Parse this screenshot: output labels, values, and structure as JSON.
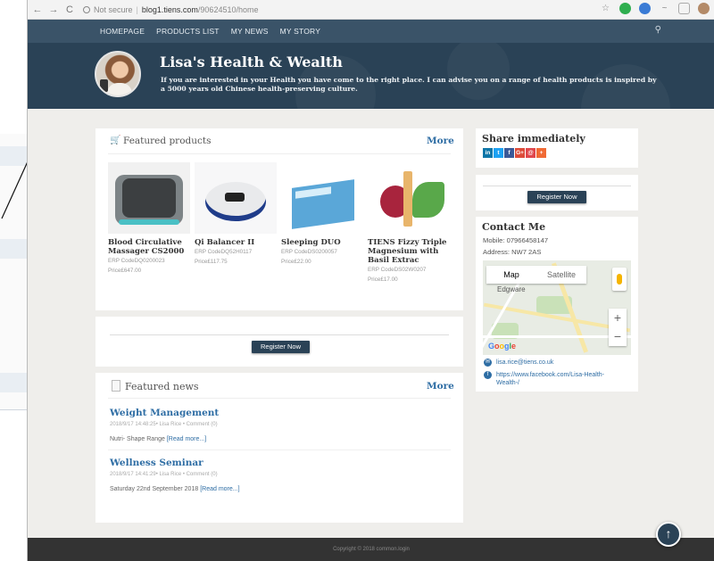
{
  "browser": {
    "nav_back": "←",
    "nav_forward": "→",
    "nav_reload": "C",
    "security_icon": "info-icon",
    "security_label": "Not secure",
    "url_host": "blog1.tiens.com",
    "url_path": "/90624510/home"
  },
  "nav": {
    "items": [
      "HOMEPAGE",
      "PRODUCTS LIST",
      "MY NEWS",
      "MY STORY"
    ],
    "search_icon": "search-icon"
  },
  "header": {
    "title": "Lisa's Health & Wealth",
    "intro": "If you are interested in your Health you have come to the right place. I can advise you on a range of health products is inspired by a 5000 years old Chinese health-preserving culture."
  },
  "featured_products": {
    "title": "Featured products",
    "more": "More",
    "cart_icon": "cart-icon",
    "items": [
      {
        "name": "Blood Circulative Massager CS2000",
        "code": "ERP CodeDQ0200023",
        "price": "Price£647.00"
      },
      {
        "name": "Qi Balancer II",
        "code": "ERP CodeDQ52H0117",
        "price": "Price£117.75"
      },
      {
        "name": "Sleeping DUO",
        "code": "ERP CodeDS0200057",
        "price": "Price£22.00"
      },
      {
        "name": "TIENS Fizzy Triple Magnesium with Basil Extrac",
        "code": "ERP CodeDS02W0207",
        "price": "Price£17.00"
      }
    ]
  },
  "register": {
    "label": "Register Now"
  },
  "featured_news": {
    "title": "Featured news",
    "more": "More",
    "doc_icon": "document-icon",
    "items": [
      {
        "title": "Weight Management",
        "meta": "2018/9/17 14:48:25• Lisa Rice • Comment (0)",
        "summary": "Nutri- Shape Range",
        "read_more": "[Read more...]"
      },
      {
        "title": "Wellness Seminar",
        "meta": "2018/9/17 14:41:29• Lisa Rice • Comment (0)",
        "summary": "Saturday 22nd September 2018",
        "read_more": "[Read more...]"
      }
    ]
  },
  "share": {
    "title": "Share immediately",
    "icons": [
      {
        "glyph": "in",
        "name": "linkedin-icon",
        "color": "#0e76a8"
      },
      {
        "glyph": "t",
        "name": "twitter-icon",
        "color": "#1da1f2"
      },
      {
        "glyph": "f",
        "name": "facebook-icon",
        "color": "#3b5998"
      },
      {
        "glyph": "G+",
        "name": "google-plus-icon",
        "color": "#dd4b39"
      },
      {
        "glyph": "@",
        "name": "email-icon",
        "color": "#e0474c"
      },
      {
        "glyph": "+",
        "name": "more-share-icon",
        "color": "#f06a35"
      }
    ]
  },
  "contact": {
    "title": "Contact Me",
    "mobile": "Mobile: 07966458147",
    "address": "Address: NW7 2AS",
    "email": "lisa.rice@tiens.co.uk",
    "facebook": "https://www.facebook.com/Lisa-Health-Wealth-/"
  },
  "map": {
    "tab_map": "Map",
    "tab_satellite": "Satellite",
    "place_label": "Edgware",
    "zoom_in": "+",
    "zoom_out": "−",
    "logo": "Google"
  },
  "footer": {
    "text": "Copyright © 2018 common.login"
  },
  "back_to_top": {
    "glyph": "↑"
  },
  "colors": {
    "header_bg": "#2a4256",
    "link": "#2e6da4",
    "page_bg": "#efeeeb"
  }
}
